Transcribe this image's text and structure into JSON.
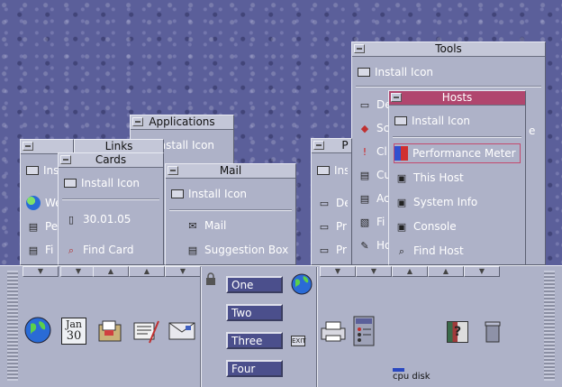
{
  "windows": {
    "tools": {
      "title": "Tools",
      "install_label": "Install Icon",
      "items": [
        "De",
        "Sc",
        "Cl",
        "Cu",
        "Ac",
        "Fi",
        "Ho"
      ],
      "partial_right": "e"
    },
    "hosts": {
      "title": "Hosts",
      "install_label": "Install Icon",
      "items": [
        "Performance Meter",
        "This Host",
        "System Info",
        "Console",
        "Find Host"
      ]
    },
    "applications": {
      "title": "Applications",
      "install_label": "Install Icon"
    },
    "links": {
      "title": "Links",
      "install_label": "Ins",
      "items": [
        "We",
        "Pe",
        "Fi"
      ]
    },
    "cards": {
      "title": "Cards",
      "install_label": "Install Icon",
      "items": [
        "30.01.05",
        "Find Card"
      ]
    },
    "mail": {
      "title": "Mail",
      "install_label": "Install Icon",
      "items": [
        "Mail",
        "Suggestion Box"
      ]
    },
    "printers": {
      "title": "P",
      "install_label": "Ins",
      "items": [
        "De",
        "Pri",
        "Pri"
      ]
    }
  },
  "front_panel": {
    "calendar": {
      "month": "Jan",
      "day": "30"
    },
    "workspaces": [
      "One",
      "Two",
      "Three",
      "Four"
    ],
    "exit_label": "EXIT",
    "meters": {
      "cpu": "cpu",
      "disk": "disk"
    },
    "help_glyph": "?"
  },
  "icons": [
    "globe-icon",
    "calendar-icon",
    "file-manager-icon",
    "text-editor-icon",
    "mailer-icon",
    "lock-icon",
    "printer-icon",
    "style-manager-icon",
    "help-icon",
    "trash-icon"
  ],
  "colors": {
    "desktop": "#5b5f9a",
    "panel": "#aeb2c8",
    "active_title": "#b0466e",
    "workspace_button": "#4b4f8c"
  }
}
